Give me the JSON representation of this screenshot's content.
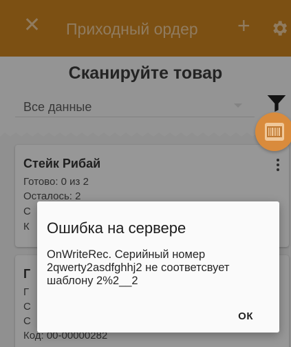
{
  "appbar": {
    "title": "Приходный ордер",
    "close_icon": "close-icon",
    "add_icon": "plus-icon",
    "settings_icon": "gear-icon",
    "color": "#c8821f"
  },
  "header": {
    "scan_title": "Сканируйте товар",
    "filter_value": "Все данные"
  },
  "cards": [
    {
      "name": "Стейк Рибай",
      "lines": [
        "Готово: 0 из 2",
        "Осталось: 2",
        "С",
        "К"
      ]
    },
    {
      "name": "Г",
      "lines": [
        "Г",
        "С",
        "С",
        "Код: 00-00000282"
      ]
    }
  ],
  "dialog": {
    "title": "Ошибка на сервере",
    "message": "OnWriteRec. Серийный номер 2qwerty2asdfghhj2 не соответсвует шаблону 2%2__2",
    "ok_label": "ОК"
  }
}
